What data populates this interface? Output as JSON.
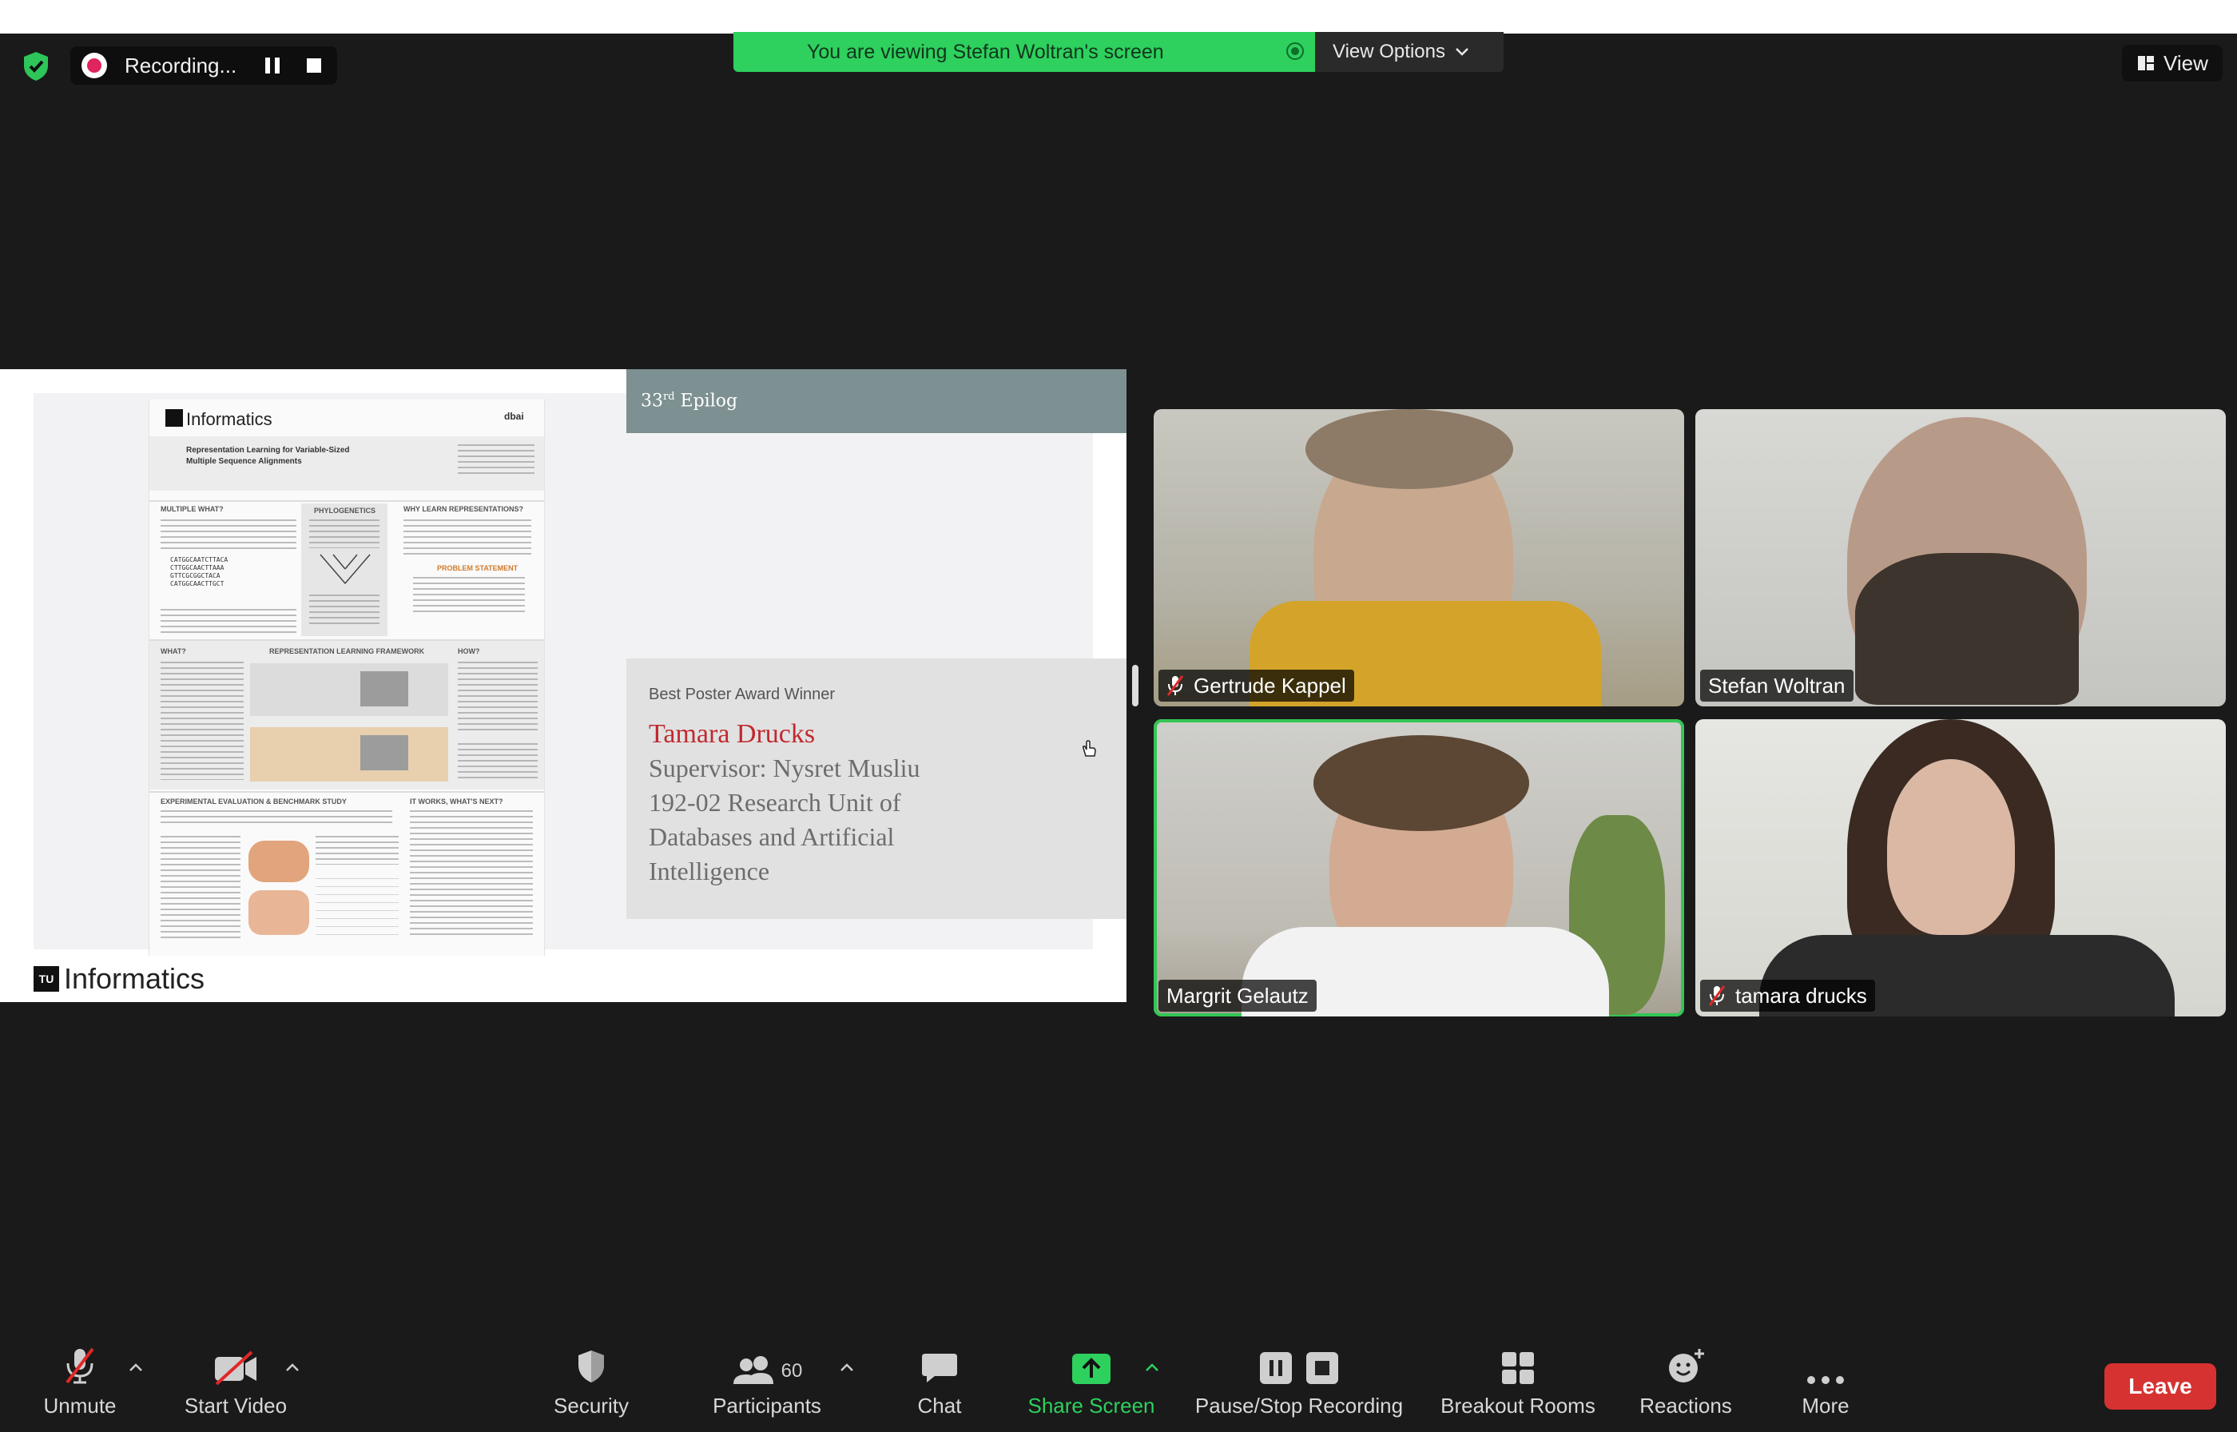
{
  "recording": {
    "label": "Recording..."
  },
  "banner": {
    "text": "You are viewing Stefan Woltran's screen",
    "view_options": "View Options"
  },
  "view_button": {
    "label": "View"
  },
  "slide": {
    "epilog": "33rd Epilog",
    "award_label": "Best Poster Award Winner",
    "winner": "Tamara Drucks",
    "supervisor_lines": [
      "Supervisor: Nysret Musliu",
      "192-02 Research Unit of",
      "Databases and Artificial",
      "Intelligence"
    ],
    "logo_text": "Informatics",
    "logo_mark": "TU",
    "poster": {
      "brand": "Informatics",
      "dbai": "dbai",
      "title_lines": [
        "Representation Learning for Variable-Sized",
        "Multiple Sequence Alignments"
      ],
      "sections": [
        "MULTIPLE WHAT?",
        "PHYLOGENETICS",
        "WHY LEARN REPRESENTATIONS?",
        "WHAT?",
        "REPRESENTATION LEARNING FRAMEWORK",
        "HOW?",
        "EXPERIMENTAL EVALUATION & BENCHMARK STUDY",
        "IT WORKS, WHAT'S NEXT?"
      ],
      "problem": "PROBLEM STATEMENT"
    }
  },
  "participants": [
    {
      "name": "Gertrude Kappel",
      "muted": true
    },
    {
      "name": "Stefan Woltran",
      "muted": false
    },
    {
      "name": "Margrit Gelautz",
      "muted": false
    },
    {
      "name": "tamara drucks",
      "muted": true
    }
  ],
  "toolbar": {
    "unmute": "Unmute",
    "start_video": "Start Video",
    "security": "Security",
    "participants": "Participants",
    "participants_count": "60",
    "chat": "Chat",
    "share_screen": "Share Screen",
    "pause_stop": "Pause/Stop Recording",
    "breakout": "Breakout Rooms",
    "reactions": "Reactions",
    "more": "More",
    "leave": "Leave"
  },
  "colors": {
    "share_green": "#2ed05e",
    "record_red": "#e0245e",
    "leave_red": "#d63232",
    "award_red": "#c0292f"
  }
}
